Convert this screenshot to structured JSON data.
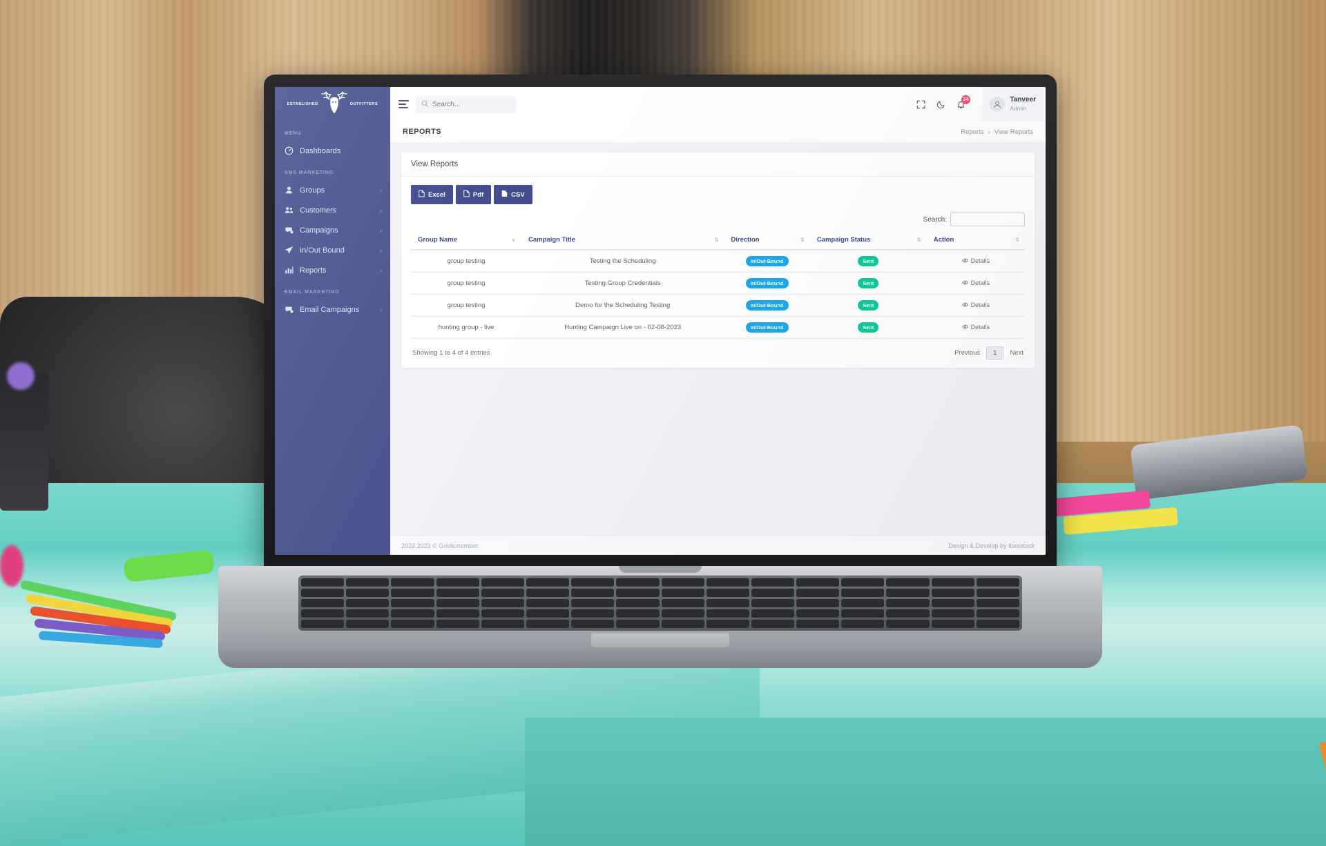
{
  "brand": {
    "left_text": "ESTABLISHED",
    "right_text": "OUTFITTERS",
    "logo_icon": "deer-head-icon"
  },
  "sidebar": {
    "sections": [
      {
        "label": "MENU",
        "items": [
          {
            "label": "Dashboards",
            "icon": "dashboard-icon",
            "has_chevron": false
          }
        ]
      },
      {
        "label": "SMS MARKETING",
        "items": [
          {
            "label": "Groups",
            "icon": "user-icon",
            "has_chevron": true
          },
          {
            "label": "Customers",
            "icon": "users-icon",
            "has_chevron": true
          },
          {
            "label": "Campaigns",
            "icon": "message-icon",
            "has_chevron": true
          },
          {
            "label": "In/Out Bound",
            "icon": "send-icon",
            "has_chevron": true
          },
          {
            "label": "Reports",
            "icon": "bar-chart-icon",
            "has_chevron": true
          }
        ]
      },
      {
        "label": "EMAIL MARKETING",
        "items": [
          {
            "label": "Email Campaigns",
            "icon": "message-icon",
            "has_chevron": true
          }
        ]
      }
    ]
  },
  "topbar": {
    "menu_toggle_icon": "hamburger-icon",
    "search": {
      "placeholder": "Search...",
      "value": "",
      "icon": "search-icon"
    },
    "fullscreen_icon": "fullscreen-icon",
    "darkmode_icon": "moon-icon",
    "notifications": {
      "icon": "bell-icon",
      "count": "24"
    },
    "user": {
      "name": "Tanveer",
      "role": "Admin",
      "avatar_icon": "avatar-icon"
    }
  },
  "page": {
    "title": "REPORTS",
    "breadcrumb": {
      "parent": "Reports",
      "separator": "›",
      "current": "View Reports"
    }
  },
  "card": {
    "title": "View Reports",
    "export_buttons": [
      {
        "label": "Excel",
        "icon": "file-excel-icon"
      },
      {
        "label": "Pdf",
        "icon": "file-pdf-icon"
      },
      {
        "label": "CSV",
        "icon": "file-csv-icon"
      }
    ],
    "search": {
      "label": "Search:",
      "value": "",
      "placeholder": ""
    }
  },
  "table": {
    "columns": [
      {
        "label": "Group Name",
        "sortable": true
      },
      {
        "label": "Campaign Title",
        "sortable": true
      },
      {
        "label": "Direction",
        "sortable": true
      },
      {
        "label": "Campaign Status",
        "sortable": true
      },
      {
        "label": "Action",
        "sortable": true
      }
    ],
    "rows": [
      {
        "group_name": "group testing",
        "campaign_title": "Testing the Scheduling",
        "direction": "In/Out-Bound",
        "status": "Sent",
        "action": "Details"
      },
      {
        "group_name": "group testing",
        "campaign_title": "Testing Group Credentials",
        "direction": "In/Out-Bound",
        "status": "Sent",
        "action": "Details"
      },
      {
        "group_name": "group testing",
        "campaign_title": "Demo for the Scheduling Testing",
        "direction": "In/Out-Bound",
        "status": "Sent",
        "action": "Details"
      },
      {
        "group_name": "hunting group - live",
        "campaign_title": "Hunting Campaign Live on - 02-08-2023",
        "direction": "In/Out-Bound",
        "status": "Sent",
        "action": "Details"
      }
    ],
    "info": "Showing 1 to 4 of 4 entries",
    "pagination": {
      "previous": "Previous",
      "current_page": "1",
      "next": "Next"
    }
  },
  "footer": {
    "left": "2023 2023 © Guidemember.",
    "right": "Design & Develop by Ibexstock"
  },
  "colors": {
    "sidebar": "#4a558f",
    "accent": "#3f4b8c",
    "direction_badge": "#1aa8ea",
    "sent_badge": "#10c99a",
    "notification_badge": "#f1556c"
  }
}
